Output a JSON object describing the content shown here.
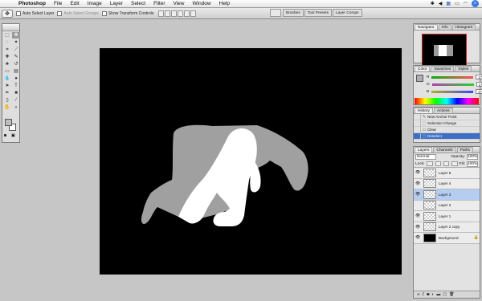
{
  "menubar": {
    "app_name": "Photoshop",
    "items": [
      "File",
      "Edit",
      "Image",
      "Layer",
      "Select",
      "Filter",
      "View",
      "Window",
      "Help"
    ],
    "status_icons": [
      "bluetooth-icon",
      "audio-icon",
      "flag-icon",
      "battery-icon",
      "wifi-icon",
      "spotlight-icon"
    ]
  },
  "options": {
    "auto_select_layer": "Auto Select Layer",
    "auto_select_groups": "Auto Select Groups",
    "show_transform_controls": "Show Transform Controls",
    "palette_tabs": [
      "Brushes",
      "Tool Presets",
      "Layer Comps"
    ]
  },
  "navigator": {
    "tabs": [
      "Navigator",
      "Info",
      "Histogram"
    ],
    "zoom": "50%"
  },
  "color": {
    "tabs": [
      "Color",
      "Swatches",
      "Styles"
    ],
    "channels": [
      {
        "label": "R",
        "value": "175",
        "color": "#d04040"
      },
      {
        "label": "G",
        "value": "175",
        "color": "#40a040"
      },
      {
        "label": "B",
        "value": "175",
        "color": "#4060d0"
      }
    ]
  },
  "history": {
    "tabs": [
      "History",
      "Actions"
    ],
    "items": [
      "New Anchor Point",
      "Selection Change",
      "Clear",
      "Deselect"
    ],
    "selected_index": 3
  },
  "layers": {
    "tabs": [
      "Layers",
      "Channels",
      "Paths"
    ],
    "blend_mode": "Normal",
    "opacity_label": "Opacity:",
    "opacity": "100%",
    "lock_label": "Lock:",
    "fill_label": "Fill:",
    "fill": "100%",
    "items": [
      {
        "name": "Layer 5",
        "visible": true,
        "selected": false,
        "lock": false
      },
      {
        "name": "Layer 4",
        "visible": true,
        "selected": false,
        "lock": false
      },
      {
        "name": "Layer 3",
        "visible": true,
        "selected": true,
        "lock": false
      },
      {
        "name": "Layer 2",
        "visible": false,
        "selected": false,
        "lock": false
      },
      {
        "name": "Layer 1",
        "visible": true,
        "selected": false,
        "lock": false
      },
      {
        "name": "Layer 2 copy",
        "visible": true,
        "selected": false,
        "lock": false
      },
      {
        "name": "Background",
        "visible": true,
        "selected": false,
        "lock": true
      }
    ]
  },
  "colors": {
    "menubar_bg": "#eeeeee",
    "workspace_bg": "#c6c6c6",
    "canvas_bg": "#000000",
    "figure_gray": "#a0a0a0",
    "figure_white": "#ffffff",
    "selection_blue": "#3d6fc7"
  }
}
